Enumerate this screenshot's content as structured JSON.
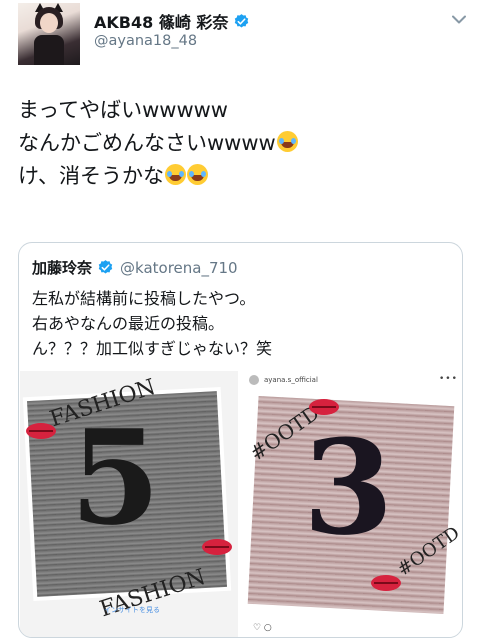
{
  "tweet": {
    "author_name": "AKB48 篠崎 彩奈",
    "author_handle": "@ayana18_48",
    "lines": [
      "まってやばいwwwww",
      "なんかごめんなさいwwww",
      "け、消そうかな"
    ],
    "emoji": "face-with-tears-of-joy-icon"
  },
  "quote": {
    "author_name": "加藤玲奈",
    "author_handle": "@katorena_710",
    "lines": [
      "左私が結構前に投稿したやつ。",
      "右あやなんの最近の投稿。",
      "ん？？？加工似すぎじゃない？笑"
    ],
    "media_left": {
      "overlay_top": "FASHION",
      "number": "5",
      "overlay_bottom": "FASHION",
      "insight_link": "インサイトを見る"
    },
    "media_right": {
      "account": "ayana.s_official",
      "overlay_top": "#OOTD",
      "number": "3",
      "overlay_bottom": "#OOTD"
    }
  },
  "colors": {
    "verified_blue": "#1da1f2",
    "handle_gray": "#657786",
    "border": "#ccd6dd",
    "lips_red": "#d6223e"
  }
}
